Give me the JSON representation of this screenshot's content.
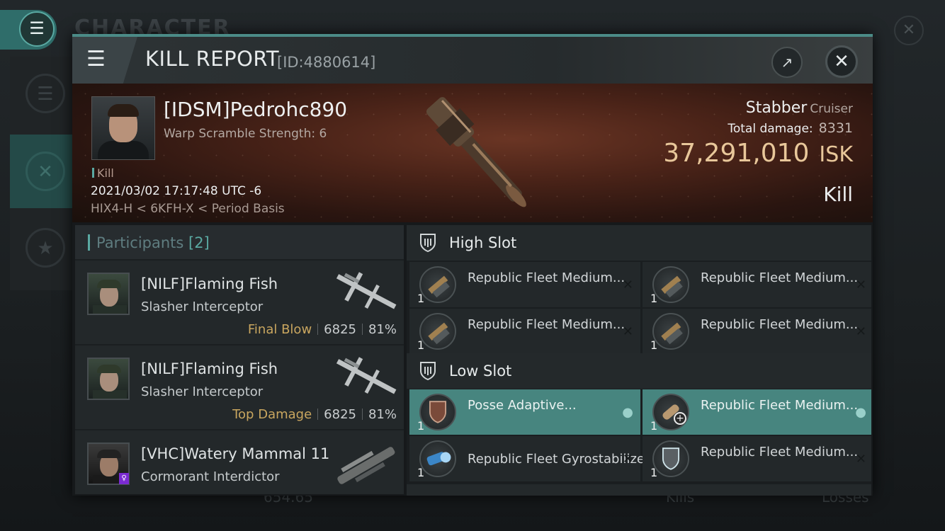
{
  "background": {
    "title": "CHARACTER",
    "menu_icon": "menu-icon",
    "bottom_value": "654.65",
    "bottom_kills": "Kills",
    "bottom_losses": "Losses"
  },
  "modal": {
    "title": "KILL REPORT",
    "id": "[ID:4880614]"
  },
  "victim": {
    "name": "[IDSM]Pedrohc890",
    "warp_scramble": "Warp Scramble Strength: 6",
    "tag": "Kill",
    "datetime": "2021/03/02 17:17:48 UTC -6",
    "location": "HIX4-H < 6KFH-X < Period Basis",
    "ship": "Stabber",
    "ship_class": "Cruiser",
    "total_damage_label": "Total damage:",
    "total_damage": "8331",
    "isk_value": "37,291,010",
    "isk_unit": "ISK",
    "result": "Kill"
  },
  "participants": {
    "label": "Participants",
    "count": "[2]",
    "rows": [
      {
        "name": "[NILF]Flaming Fish",
        "ship": "Slasher Interceptor",
        "label": "Final Blow",
        "damage": "6825",
        "percent": "81%"
      },
      {
        "name": "[NILF]Flaming Fish",
        "ship": "Slasher Interceptor",
        "label": "Top Damage",
        "damage": "6825",
        "percent": "81%"
      },
      {
        "name": "[VHC]Watery Mammal 11",
        "ship": "Cormorant Interdictor",
        "label": "",
        "damage": "",
        "percent": ""
      }
    ]
  },
  "slots": {
    "high": {
      "title": "High Slot",
      "items": [
        {
          "name": "Republic Fleet Medium...",
          "qty": "1",
          "status": "✕"
        },
        {
          "name": "Republic Fleet Medium...",
          "qty": "1",
          "status": "✕"
        },
        {
          "name": "Republic Fleet Medium...",
          "qty": "1",
          "status": "✕"
        },
        {
          "name": "Republic Fleet Medium...",
          "qty": "1",
          "status": "✕"
        }
      ]
    },
    "low": {
      "title": "Low Slot",
      "items": [
        {
          "name": "Posse Adaptive...",
          "qty": "1",
          "status": "person",
          "fitted": true
        },
        {
          "name": "Republic Fleet Medium...",
          "qty": "1",
          "status": "person",
          "fitted": true
        },
        {
          "name": "Republic Fleet Gyrostabilizer",
          "qty": "1",
          "status": "✕"
        },
        {
          "name": "Republic Fleet Medium...",
          "qty": "1",
          "status": "✕"
        }
      ]
    }
  },
  "colors": {
    "accent": "#5aa9a2",
    "fitted": "#47857f",
    "isk": "#e8c79a",
    "final_blow": "#c9a65f"
  }
}
